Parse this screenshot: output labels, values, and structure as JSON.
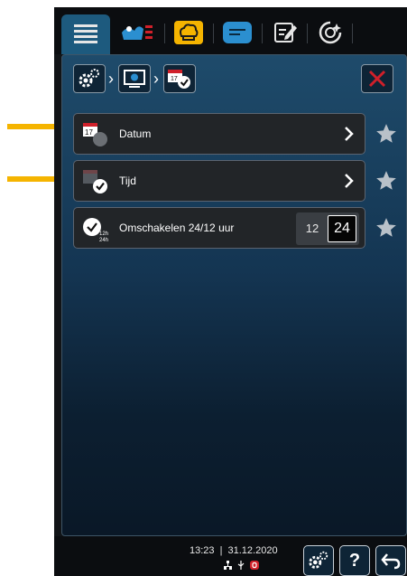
{
  "top_tabs": [
    {
      "name": "menu"
    },
    {
      "name": "cleaning"
    },
    {
      "name": "cooking"
    },
    {
      "name": "programs"
    },
    {
      "name": "edit"
    },
    {
      "name": "extras"
    }
  ],
  "breadcrumb": [
    {
      "name": "settings-gear"
    },
    {
      "name": "display"
    },
    {
      "name": "date-time"
    }
  ],
  "rows": {
    "date": {
      "label": "Datum"
    },
    "time": {
      "label": "Tijd"
    },
    "switch": {
      "label": "Omschakelen 24/12 uur",
      "option_a": "12",
      "option_b": "24",
      "selected": "24",
      "icon_small_a": "12h",
      "icon_small_b": "24h"
    }
  },
  "status": {
    "time": "13:23",
    "separator": "|",
    "date": "31.12.2020"
  },
  "bottom_buttons": {
    "help": "?"
  },
  "colors": {
    "accent": "#1d5a7e",
    "close": "#d0202a",
    "annotation": "#f5b400"
  }
}
